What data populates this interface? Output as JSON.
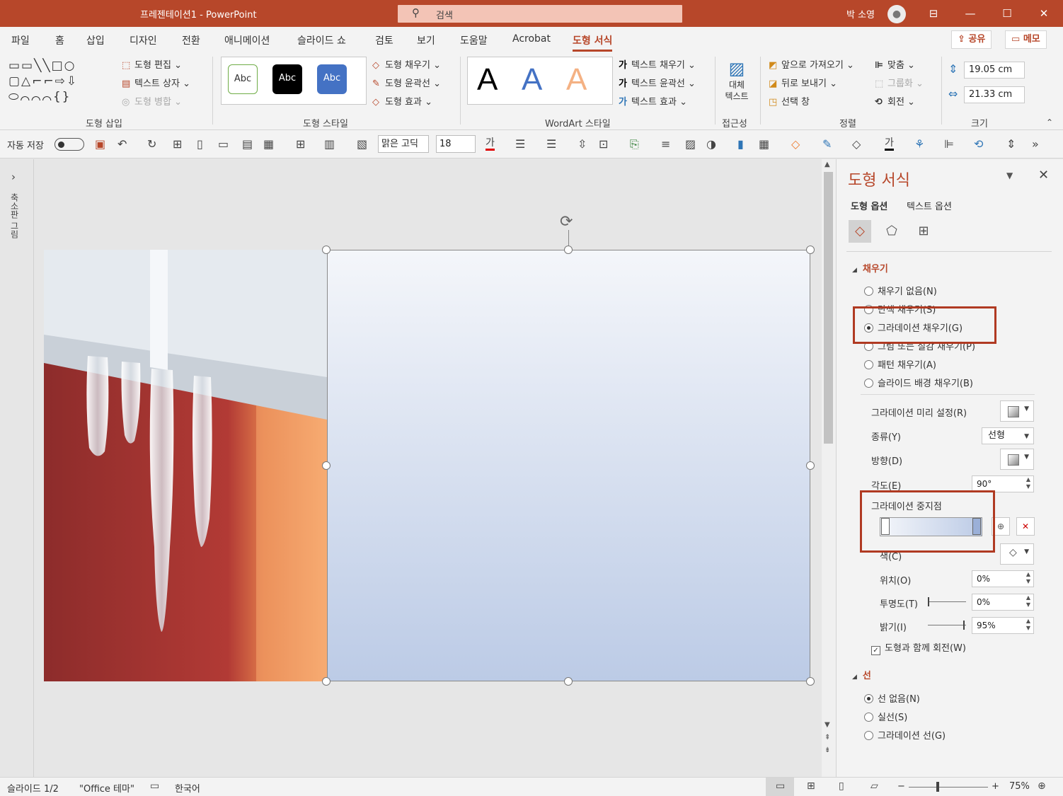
{
  "window": {
    "title": "프레젠테이션1  -  PowerPoint",
    "search_placeholder": "검색",
    "user": "박 소영",
    "minimize": "—",
    "maximize": "☐",
    "close": "✕",
    "ribbon_display": "⊟"
  },
  "colors": {
    "accent": "#b7472a",
    "highlight_box": "#b03a22",
    "gradient_top": "#f4f6fa",
    "gradient_bottom": "#bccbe6"
  },
  "tabs": [
    "파일",
    "홈",
    "삽입",
    "디자인",
    "전환",
    "애니메이션",
    "슬라이드 쇼",
    "검토",
    "보기",
    "도움말",
    "Acrobat",
    "도형 서식"
  ],
  "share_label": "공유",
  "comment_label": "메모",
  "ribbon": {
    "insert_shapes": {
      "edit_shape": "도형 편집",
      "text_box": "텍스트 상자",
      "merge_shapes": "도형 병합",
      "label": "도형 삽입"
    },
    "shape_styles": {
      "samples": [
        "Abc",
        "Abc",
        "Abc"
      ],
      "fill": "도형 채우기",
      "outline": "도형 윤곽선",
      "effects": "도형 효과",
      "label": "도형 스타일"
    },
    "wordart": {
      "samples": [
        "A",
        "A",
        "A"
      ],
      "text_fill": "텍스트 채우기",
      "text_outline": "텍스트 윤곽선",
      "text_effects": "텍스트 효과",
      "label": "WordArt 스타일"
    },
    "accessibility": {
      "alt_text_line1": "대체",
      "alt_text_line2": "텍스트",
      "label": "접근성"
    },
    "arrange": {
      "bring_forward": "앞으로 가져오기",
      "send_backward": "뒤로 보내기",
      "selection_pane": "선택 창",
      "align": "맞춤",
      "group": "그룹화",
      "rotate": "회전",
      "label": "정렬"
    },
    "size": {
      "height": "19.05 cm",
      "width": "21.33 cm",
      "label": "크기"
    }
  },
  "qat": {
    "autosave": "자동 저장",
    "font": "맑은 고딕",
    "font_size": "18",
    "font_color_glyph": "가",
    "text_fill_glyph": "가"
  },
  "left_pane_label": "축소판 그림",
  "panel": {
    "title": "도형 서식",
    "tab_shape": "도형 옵션",
    "tab_text": "텍스트 옵션",
    "fill_section": "채우기",
    "fill_options": [
      "채우기 없음(N)",
      "단색 채우기(S)",
      "그라데이션 채우기(G)",
      "그림 또는 질감 채우기(P)",
      "패턴 채우기(A)",
      "슬라이드 배경 채우기(B)"
    ],
    "preset_label": "그라데이션 미리 설정(R)",
    "type_label": "종류(Y)",
    "type_value": "선형",
    "direction_label": "방향(D)",
    "angle_label": "각도(E)",
    "angle_value": "90°",
    "stops_label": "그라데이션 중지점",
    "color_label": "색(C)",
    "position_label": "위치(O)",
    "position_value": "0%",
    "transparency_label": "투명도(T)",
    "transparency_value": "0%",
    "brightness_label": "밝기(I)",
    "brightness_value": "95%",
    "rotate_with_shape": "도형과 함께 회전(W)",
    "line_section": "선",
    "line_options": [
      "선 없음(N)",
      "실선(S)",
      "그라데이션 선(G)"
    ]
  },
  "status": {
    "slide": "슬라이드 1/2",
    "theme": "\"Office 테마\"",
    "language": "한국어",
    "zoom": "75%"
  }
}
